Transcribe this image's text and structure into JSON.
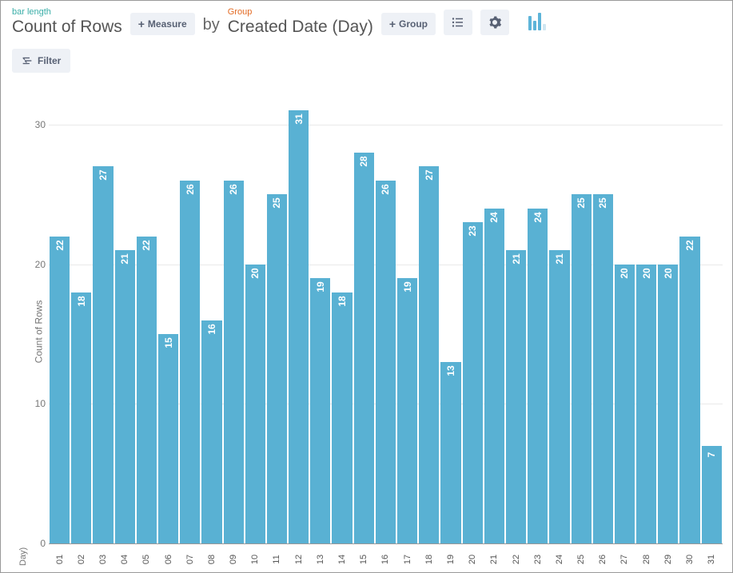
{
  "header": {
    "measure_hint": "bar length",
    "measure_value": "Count of Rows",
    "measure_button": "Measure",
    "by_label": "by",
    "group_hint": "Group",
    "group_value": "Created Date (Day)",
    "group_button": "Group"
  },
  "filter": {
    "label": "Filter"
  },
  "chart_data": {
    "type": "bar",
    "categories": [
      "01",
      "02",
      "03",
      "04",
      "05",
      "06",
      "07",
      "08",
      "09",
      "10",
      "11",
      "12",
      "13",
      "14",
      "15",
      "16",
      "17",
      "18",
      "19",
      "20",
      "21",
      "22",
      "23",
      "24",
      "25",
      "26",
      "27",
      "28",
      "29",
      "30",
      "31"
    ],
    "values": [
      22,
      18,
      27,
      21,
      22,
      15,
      26,
      16,
      26,
      20,
      25,
      31,
      19,
      18,
      28,
      26,
      19,
      27,
      13,
      23,
      24,
      21,
      24,
      21,
      25,
      25,
      20,
      20,
      20,
      22,
      7
    ],
    "ylabel": "Count of Rows",
    "xlabel": "Day)",
    "ylim": [
      0,
      32
    ],
    "y_ticks": [
      0,
      10,
      20,
      30
    ],
    "bar_color": "#59b1d3"
  }
}
